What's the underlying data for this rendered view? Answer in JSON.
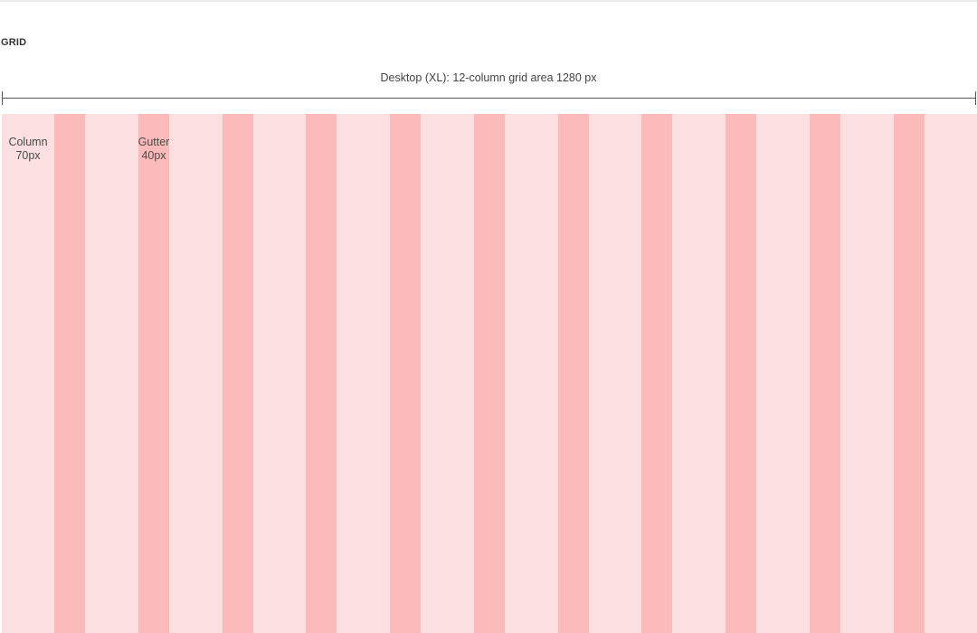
{
  "header": {
    "section_title": "GRID"
  },
  "dimension": {
    "caption": "Desktop (XL): 12-column grid area 1280 px"
  },
  "grid": {
    "columns": 12,
    "column_label": {
      "name": "Column",
      "size": "70px"
    },
    "gutter_label": {
      "name": "Gutter",
      "size": "40px"
    },
    "colors": {
      "column": "#fcdfe0",
      "gutter": "#fdbabb"
    }
  }
}
